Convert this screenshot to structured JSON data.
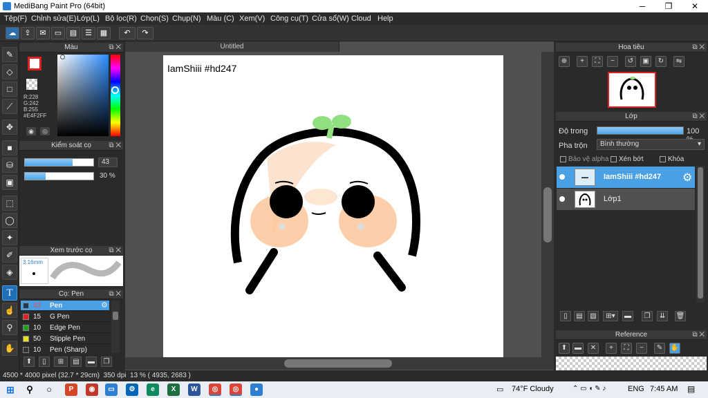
{
  "app": {
    "title": "MediBang Paint Pro (64bit)",
    "minimize": "─",
    "maximize": "❐",
    "close": "✕"
  },
  "menu": [
    "Tệp(F)",
    "Chỉnh sửa(E)",
    "Lớp(L)",
    "Bộ lọc(R)",
    "Chọn(S)",
    "Chụp(N)",
    "Màu (C)",
    "Xem(V)",
    "Công cụ(T)",
    "Cửa sổ(W)",
    "Cloud",
    "Help"
  ],
  "toolbar": {
    "undo": "↶",
    "redo": "↷"
  },
  "color_panel": {
    "title": "Màu",
    "r": "R:228",
    "g": "G:242",
    "b": "B:255",
    "hex": "#E4F2FF"
  },
  "brush_control": {
    "title": "Kiểm soát cọ",
    "size": "43",
    "opacity": "30 %",
    "size_fill": 0.7,
    "opacity_fill": 0.3
  },
  "brush_preview": {
    "title": "Xem trước cọ",
    "size": "3.16mm"
  },
  "brush_list": {
    "title": "Cọ: Pen",
    "items": [
      {
        "num": "43",
        "label": "Pen",
        "color": "#1b3a5a",
        "selected": true
      },
      {
        "num": "15",
        "label": "G Pen",
        "color": "#e02020",
        "selected": false
      },
      {
        "num": "10",
        "label": "Edge Pen",
        "color": "#20a020",
        "selected": false
      },
      {
        "num": "50",
        "label": "Stipple Pen",
        "color": "#e8e020",
        "selected": false
      },
      {
        "num": "10",
        "label": "Pen (Sharp)",
        "color": "#333333",
        "selected": false
      }
    ]
  },
  "document": {
    "tab": "Untitled",
    "text": "IamShiii #hd247"
  },
  "navigator": {
    "title": "Hoa tiêu"
  },
  "layers": {
    "title": "Lớp",
    "opacity_label": "Độ trong",
    "opacity_value": "100 %",
    "opacity_fill": 1.0,
    "blend_label": "Pha trộn",
    "blend_value": "Bình thường",
    "protect_alpha": "Bảo vệ alpha",
    "clip": "Xén bớt",
    "lock": "Khóa",
    "items": [
      {
        "name": "IamShiii #hd247",
        "selected": true
      },
      {
        "name": "Lớp1",
        "selected": false
      }
    ]
  },
  "reference": {
    "title": "Reference"
  },
  "status": {
    "size": "4500 * 4000 pixel",
    "cm": "(32.7 * 29cm)",
    "dpi": "350 dpi",
    "zoom": "13 %",
    "coords": "( 4935, 2683 )"
  },
  "taskbar": {
    "weather": "74°F Cloudy",
    "lang": "ENG",
    "time": "7:45 AM"
  },
  "colors": {
    "accent": "#4aa0e4",
    "primary": "#e02020",
    "secondary": "#f7d9b0"
  }
}
